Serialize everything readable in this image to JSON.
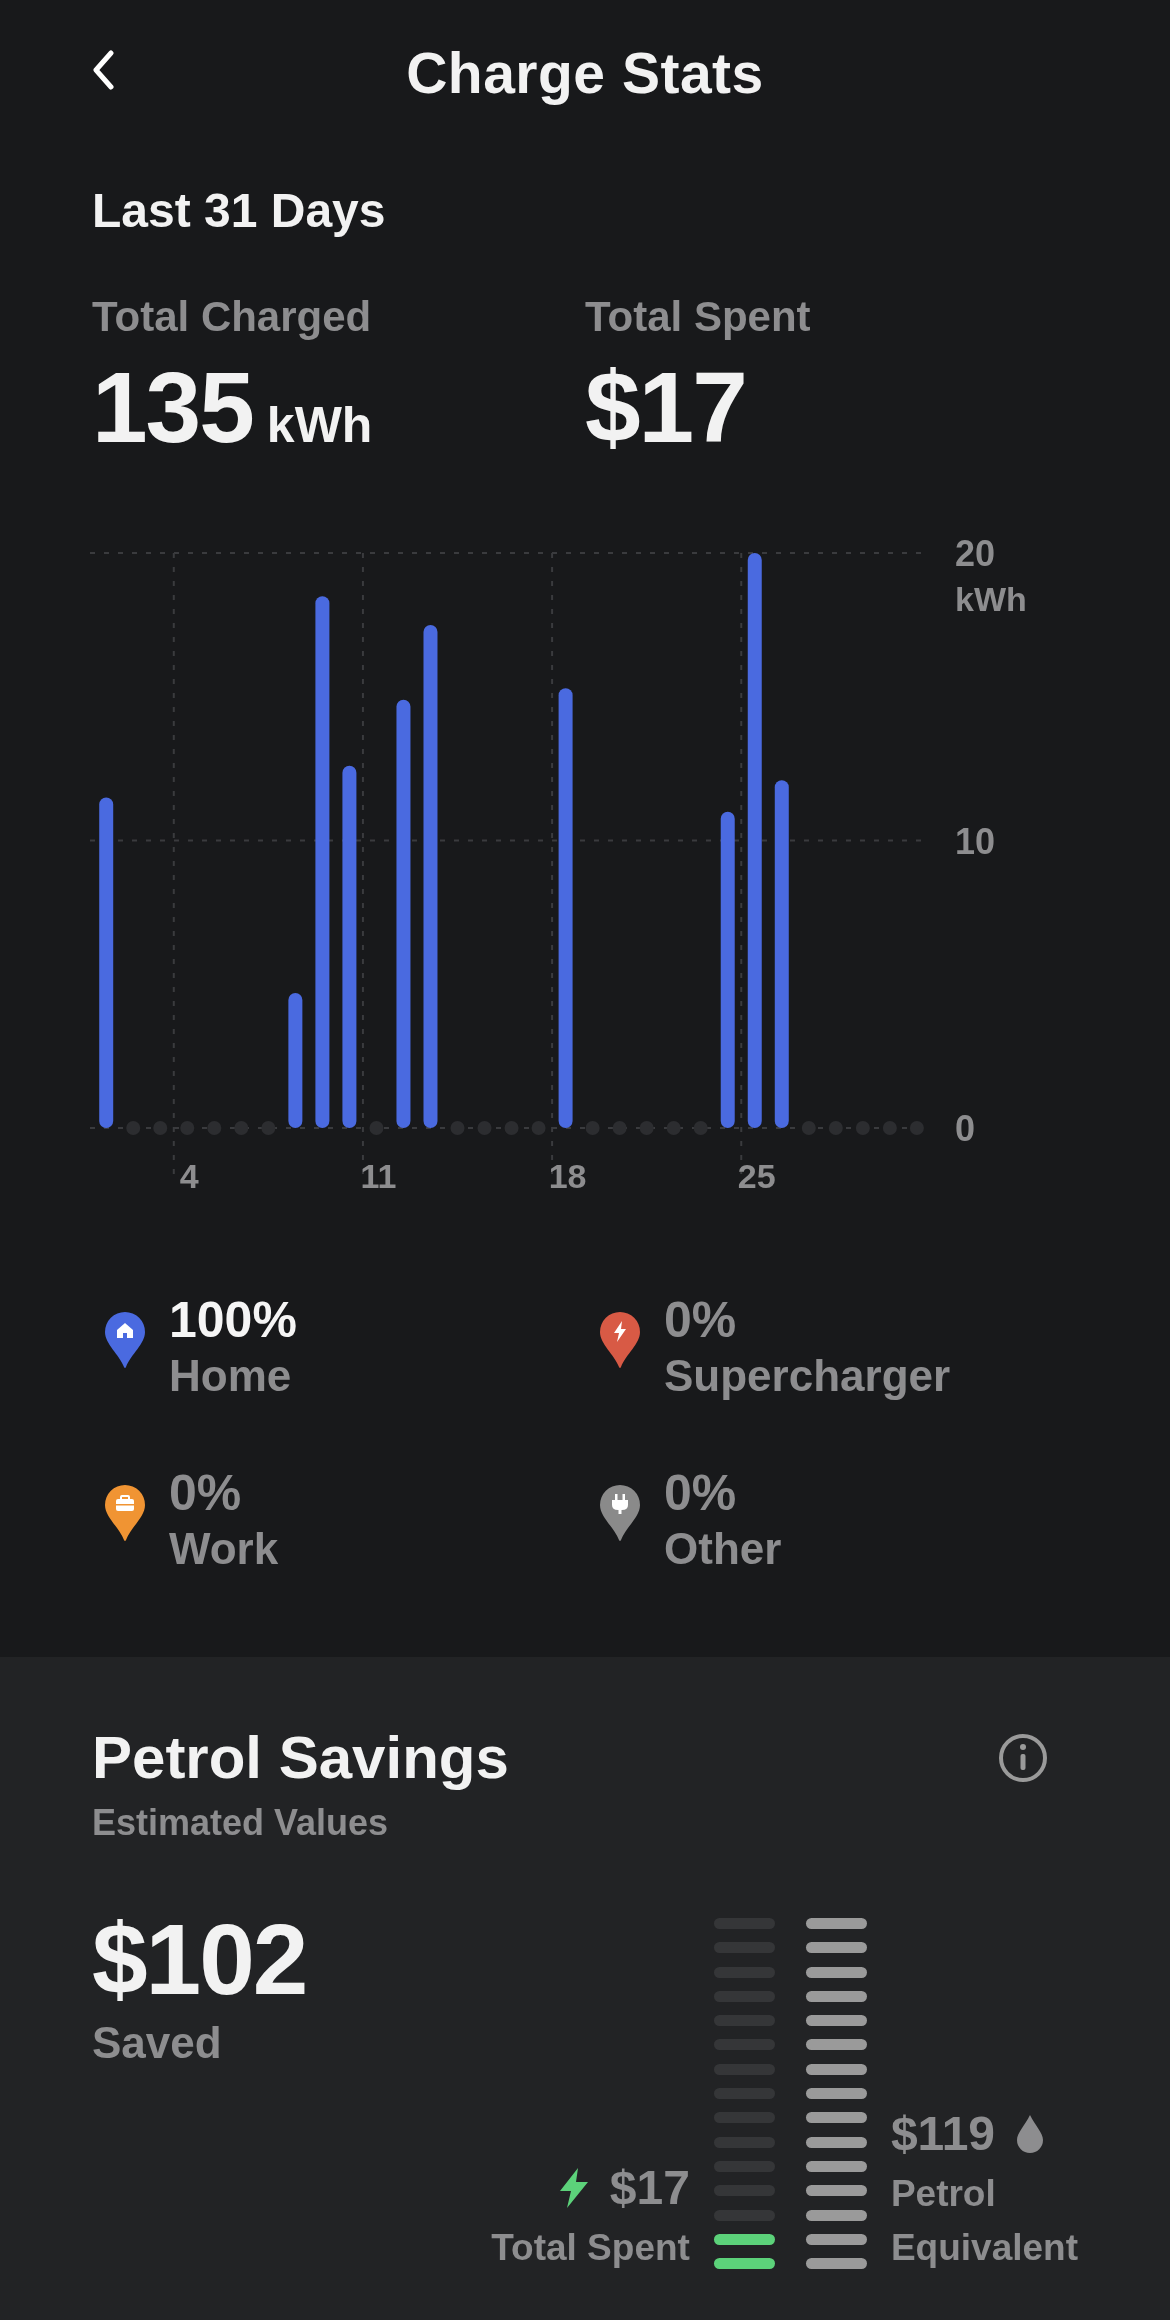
{
  "header": {
    "title": "Charge Stats"
  },
  "period": "Last 31 Days",
  "totals": [
    {
      "label": "Total Charged",
      "value": "135",
      "unit": "kWh"
    },
    {
      "label": "Total Spent",
      "value": "$17"
    }
  ],
  "chart": {
    "chart_data": {
      "type": "bar",
      "ylabel": "kWh",
      "x": [
        1,
        2,
        3,
        4,
        5,
        6,
        7,
        8,
        9,
        10,
        11,
        12,
        13,
        14,
        15,
        16,
        17,
        18,
        19,
        20,
        21,
        22,
        23,
        24,
        25,
        26,
        27,
        28,
        29,
        30,
        31
      ],
      "values": [
        11.5,
        0,
        0,
        0,
        0,
        0,
        0,
        4.7,
        18.5,
        12.6,
        0,
        14.9,
        17.5,
        0,
        0,
        0,
        0,
        15.3,
        0,
        0,
        0,
        0,
        0,
        11.0,
        20,
        12.1,
        0,
        0,
        0,
        0,
        0
      ],
      "color": "#4a6ae0",
      "grid": true,
      "xticks": [
        4,
        11,
        18,
        25
      ],
      "xlim": [
        0.4,
        31.3
      ],
      "yticks": [
        0,
        10,
        20
      ],
      "ylim": [
        0,
        20
      ]
    }
  },
  "sources": [
    {
      "kind": "home",
      "percent": "100%",
      "label": "Home",
      "color": "#4a6ae0",
      "highlighted": true
    },
    {
      "kind": "supercharger",
      "percent": "0%",
      "label": "Supercharger",
      "color": "#d85a45",
      "highlighted": false
    },
    {
      "kind": "work",
      "percent": "0%",
      "label": "Work",
      "color": "#f09433",
      "highlighted": false
    },
    {
      "kind": "other",
      "percent": "0%",
      "label": "Other",
      "color": "#8a8a8a",
      "highlighted": false
    }
  ],
  "savings": {
    "title": "Petrol Savings",
    "subtitle": "Estimated Values",
    "amount": "$102",
    "amount_label": "Saved",
    "spent": {
      "value": "$17",
      "label": "Total Spent",
      "level": 0.14
    },
    "petrol": {
      "value": "$119",
      "label_lines": [
        "Petrol",
        "Equivalent"
      ],
      "level": 1
    }
  }
}
